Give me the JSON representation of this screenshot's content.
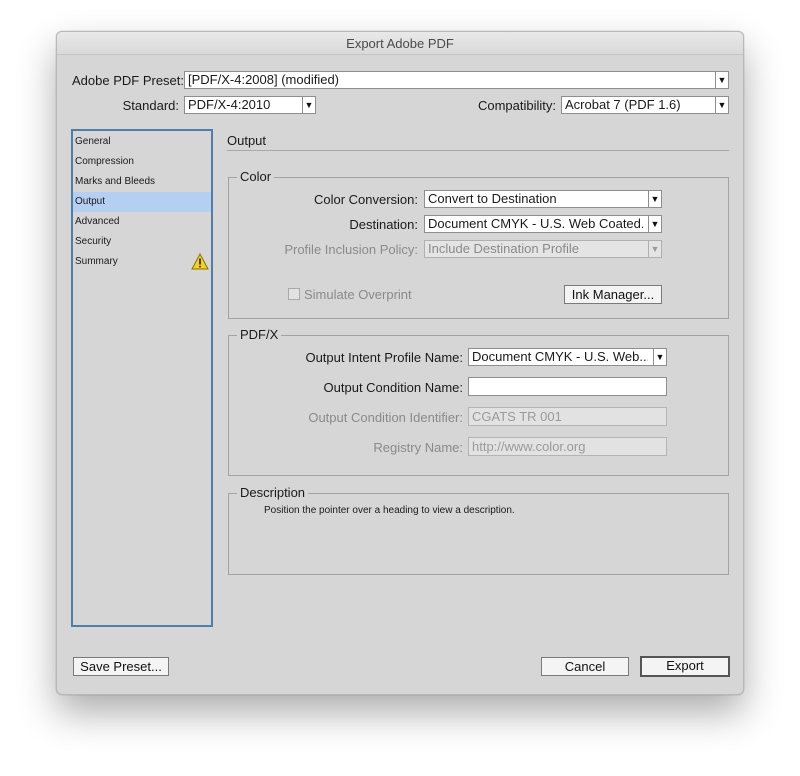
{
  "window": {
    "title": "Export Adobe PDF"
  },
  "top": {
    "preset_label": "Adobe PDF Preset:",
    "preset_value": "[PDF/X-4:2008] (modified)",
    "standard_label": "Standard:",
    "standard_value": "PDF/X-4:2010",
    "compat_label": "Compatibility:",
    "compat_value": "Acrobat 7 (PDF 1.6)"
  },
  "sidebar": {
    "items": [
      {
        "label": "General"
      },
      {
        "label": "Compression"
      },
      {
        "label": "Marks and Bleeds"
      },
      {
        "label": "Output"
      },
      {
        "label": "Advanced"
      },
      {
        "label": "Security"
      },
      {
        "label": "Summary"
      }
    ],
    "selected": "Output"
  },
  "section": {
    "title": "Output"
  },
  "color": {
    "group_title": "Color",
    "conversion_label": "Color Conversion:",
    "conversion_value": "Convert to Destination",
    "destination_label": "Destination:",
    "destination_value": "Document CMYK - U.S. Web Coated...",
    "policy_label": "Profile Inclusion Policy:",
    "policy_value": "Include Destination Profile",
    "simulate_label": "Simulate Overprint",
    "ink_manager_label": "Ink Manager..."
  },
  "pdfx": {
    "group_title": "PDF/X",
    "intent_label": "Output Intent Profile Name:",
    "intent_value": "Document CMYK - U.S. Web...",
    "condition_name_label": "Output Condition Name:",
    "condition_name_value": "",
    "condition_id_label": "Output Condition Identifier:",
    "condition_id_placeholder": "CGATS TR 001",
    "registry_label": "Registry Name:",
    "registry_placeholder": "http://www.color.org"
  },
  "description": {
    "group_title": "Description",
    "text": "Position the pointer over a heading to view a description."
  },
  "footer": {
    "save_preset": "Save Preset...",
    "cancel": "Cancel",
    "export": "Export"
  },
  "colors": {
    "selection": "#b5cff2",
    "sidebar_border": "#4f7ea8",
    "warning": "#f5d21a"
  },
  "icons": {
    "dropdown": "▼",
    "warning": "warning-icon"
  }
}
